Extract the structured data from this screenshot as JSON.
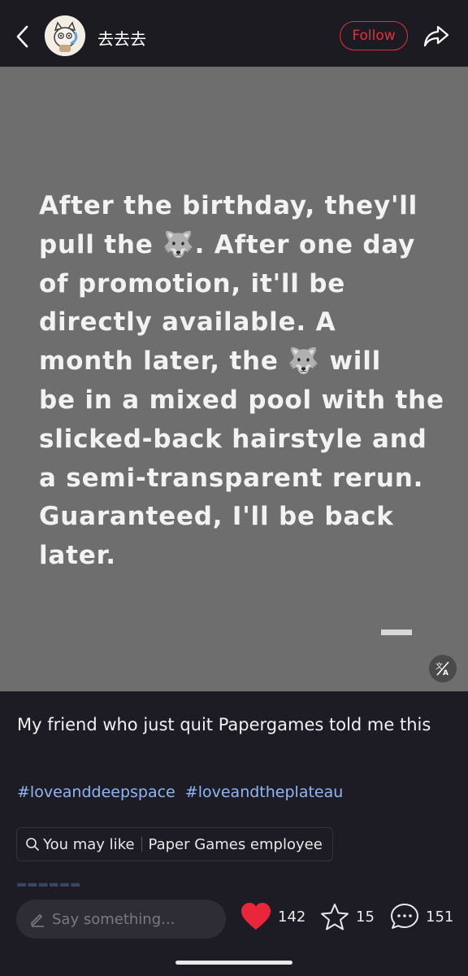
{
  "header": {
    "username": "去去去",
    "follow_label": "Follow"
  },
  "post": {
    "image_text_lines": [
      "After the birthday, they'll",
      "pull the 🐺. After one day",
      "of promotion, it'll be",
      "directly available. A",
      "month later, the 🐺 will",
      "be in a mixed pool with the",
      "slicked-back hairstyle and",
      "a semi-transparent rerun.",
      "Guaranteed, I'll be back",
      "later."
    ],
    "caption": "My friend who just quit Papergames told me this",
    "hashtags": [
      "#loveanddeepspace",
      "#loveandtheplateau"
    ],
    "you_may_like": {
      "label": "You may like",
      "suggestion": "Paper Games employee"
    }
  },
  "bottom": {
    "comment_placeholder": "Say something...",
    "likes": "142",
    "favorites": "15",
    "comments": "151",
    "like_color": "#e8283a"
  }
}
